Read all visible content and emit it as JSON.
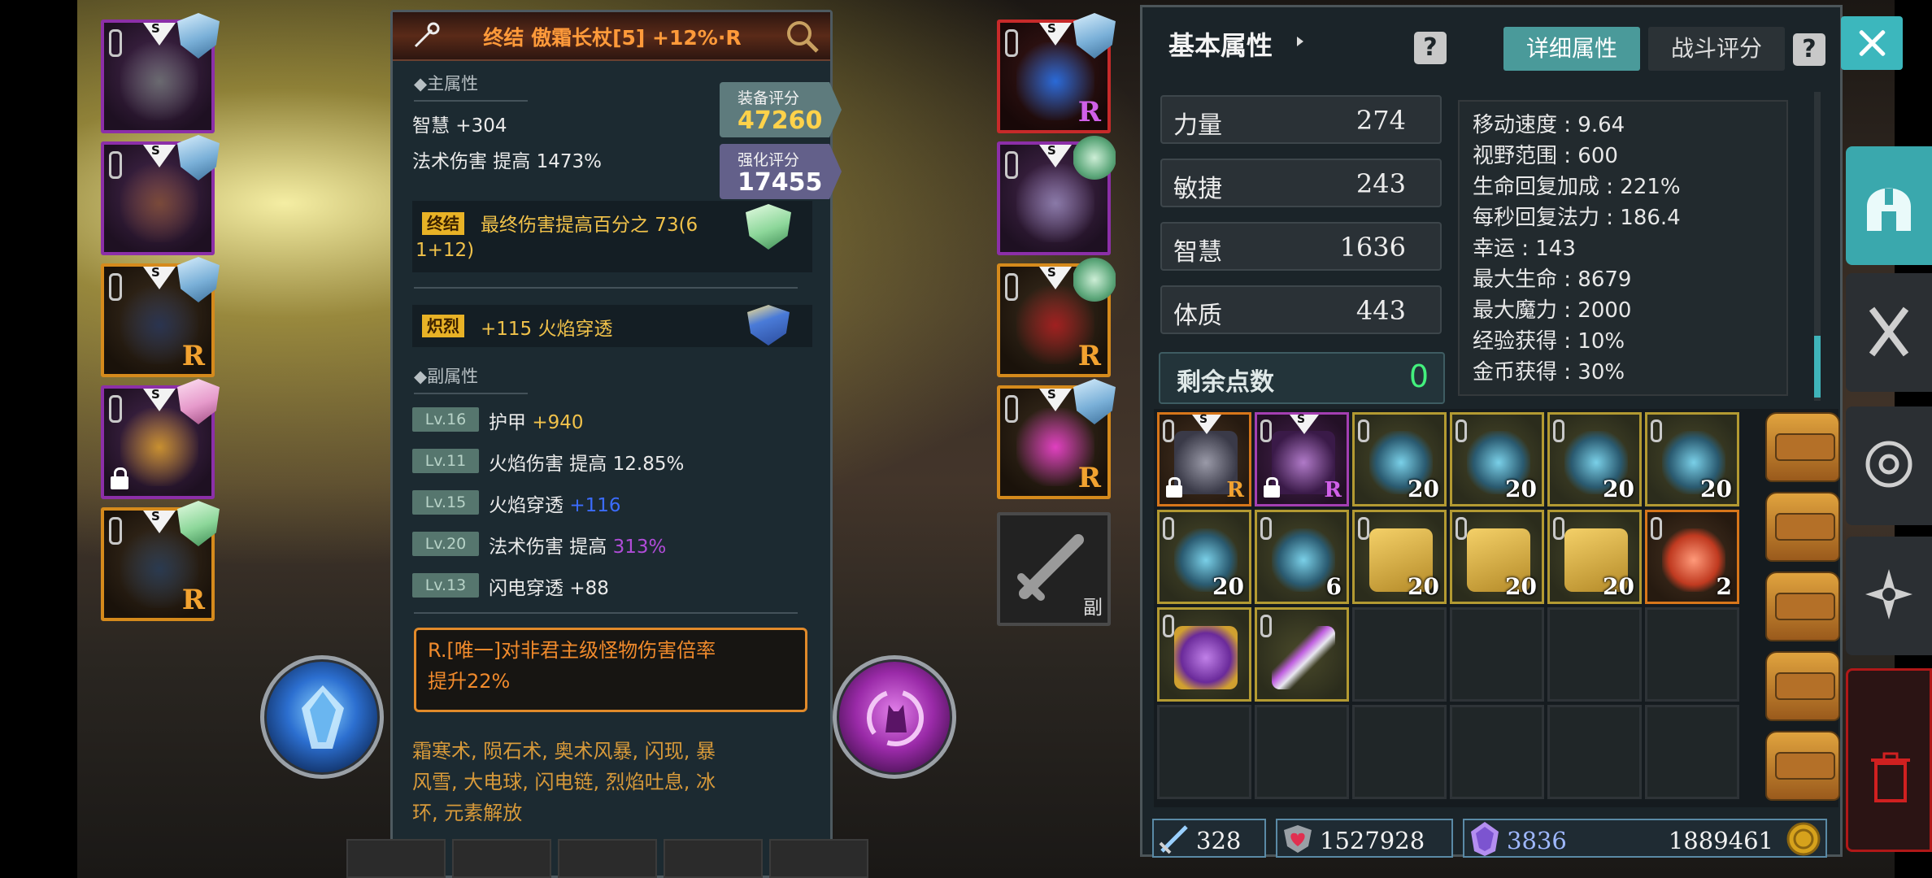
{
  "detail": {
    "title": "终结 傲霜长杖[5] +12%·R",
    "main_attr_label": "◆主属性",
    "main_stats": [
      "智慧 +304",
      "法术伤害 提高 1473%"
    ],
    "equip_score_label": "装备评分",
    "equip_score": "47260",
    "enhance_score_label": "强化评分",
    "enhance_score": "17455",
    "final_tag": "终结",
    "final_text_1": "最终伤害提高百分之 73(6",
    "final_text_2": "1+12)",
    "blaze_tag": "炽烈",
    "blaze_text": "+115 火焰穿透",
    "sub_attr_label": "◆副属性",
    "sub_stats": [
      {
        "lv": "Lv.16",
        "name": "护甲",
        "value": "+940",
        "color": "#f1c24a"
      },
      {
        "lv": "Lv.11",
        "name": "火焰伤害 提高",
        "value": "12.85%",
        "color": "#eaeaea"
      },
      {
        "lv": "Lv.15",
        "name": "火焰穿透",
        "value": "+116",
        "color": "#3b6cff"
      },
      {
        "lv": "Lv.20",
        "name": "法术伤害 提高",
        "value": "313%",
        "color": "#b04cd8"
      },
      {
        "lv": "Lv.13",
        "name": "闪电穿透",
        "value": "+88",
        "color": "#eaeaea"
      }
    ],
    "unique_line_1": "R.[唯一]对非君主级怪物伤害倍率",
    "unique_line_2": "提升22%",
    "skills_line_1": "霜寒术, 陨石术, 奥术风暴, 闪现, 暴",
    "skills_line_2": "风雪, 大电球, 闪电链, 烈焰吐息, 冰",
    "skills_line_3": "环, 元素解放"
  },
  "left_equipment": [
    {
      "name": "helmet",
      "border": "purple",
      "shield": "blue",
      "r": false,
      "lock": false
    },
    {
      "name": "chest",
      "border": "purple",
      "shield": "blue",
      "r": false,
      "lock": false
    },
    {
      "name": "legs",
      "border": "gold",
      "shield": "blue",
      "r": true,
      "lock": false
    },
    {
      "name": "ring",
      "border": "purple",
      "shield": "pink",
      "r": false,
      "lock": true
    },
    {
      "name": "weapon",
      "border": "gold",
      "shield": "green",
      "r": true,
      "lock": false
    }
  ],
  "right_equipment": [
    {
      "name": "necklace",
      "border": "red",
      "shield": "blue",
      "r": "purple"
    },
    {
      "name": "gloves",
      "border": "purple",
      "shield": "teal",
      "r": ""
    },
    {
      "name": "boots",
      "border": "gold",
      "shield": "teal",
      "r": "gold"
    },
    {
      "name": "earring",
      "border": "gold",
      "shield": "blue",
      "r": "gold"
    }
  ],
  "offhand_label": "副",
  "attributes": {
    "title": "基本属性",
    "help": "?",
    "tab_detail": "详细属性",
    "tab_battle": "战斗评分",
    "rows": [
      {
        "name": "力量",
        "value": "274"
      },
      {
        "name": "敏捷",
        "value": "243"
      },
      {
        "name": "智慧",
        "value": "1636"
      },
      {
        "name": "体质",
        "value": "443"
      }
    ],
    "remaining_label": "剩余点数",
    "remaining_value": "0",
    "details": [
      "移动速度 : 9.64",
      "视野范围 : 600",
      "生命回复加成 : 221%",
      "每秒回复法力 : 186.4",
      "幸运 : 143",
      "最大生命 : 8679",
      "最大魔力 : 2000",
      "经验获得 : 10%",
      "金币获得 : 30%"
    ]
  },
  "inventory": {
    "rows": [
      [
        {
          "type": "item",
          "border": "orange",
          "art": "armor",
          "s": true,
          "lock": true,
          "r": "R",
          "rcolor": "#f2a230",
          "count": ""
        },
        {
          "type": "item",
          "border": "purple",
          "art": "cloak",
          "s": true,
          "lock": true,
          "r": "R",
          "rcolor": "#d060e8",
          "count": ""
        },
        {
          "type": "item",
          "border": "gold",
          "art": "scroll-blue",
          "count": "20"
        },
        {
          "type": "item",
          "border": "gold",
          "art": "scroll-blue",
          "count": "20"
        },
        {
          "type": "item",
          "border": "gold",
          "art": "scroll-blue",
          "count": "20"
        },
        {
          "type": "item",
          "border": "gold",
          "art": "scroll-blue",
          "count": "20"
        }
      ],
      [
        {
          "type": "item",
          "border": "gold",
          "art": "scroll-blue",
          "count": "20"
        },
        {
          "type": "item",
          "border": "gold",
          "art": "scroll-blue",
          "count": "6"
        },
        {
          "type": "item",
          "border": "gold",
          "art": "parchment",
          "count": "20"
        },
        {
          "type": "item",
          "border": "gold",
          "art": "parchment",
          "count": "20"
        },
        {
          "type": "item",
          "border": "gold",
          "art": "parchment",
          "count": "20"
        },
        {
          "type": "item",
          "border": "orange",
          "art": "crystal",
          "count": "2"
        }
      ],
      [
        {
          "type": "item",
          "border": "gold",
          "art": "potion",
          "count": ""
        },
        {
          "type": "item",
          "border": "gold",
          "art": "dagger",
          "count": ""
        },
        {
          "type": "empty"
        },
        {
          "type": "empty"
        },
        {
          "type": "empty"
        },
        {
          "type": "empty"
        }
      ],
      [
        {
          "type": "empty"
        },
        {
          "type": "empty"
        },
        {
          "type": "empty"
        },
        {
          "type": "empty"
        },
        {
          "type": "empty"
        },
        {
          "type": "empty"
        }
      ]
    ]
  },
  "currencies": {
    "sword_count": "328",
    "heart_count": "1527928",
    "gem_count": "3836",
    "gold_count": "1889461"
  }
}
